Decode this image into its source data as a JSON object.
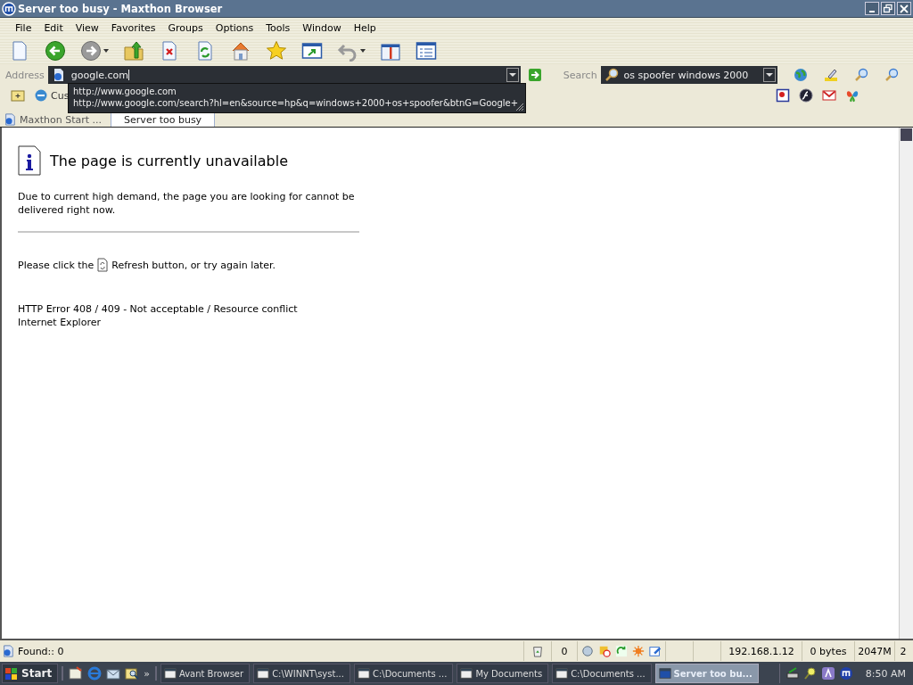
{
  "window": {
    "title": "Server too busy - Maxthon Browser"
  },
  "menu": [
    "File",
    "Edit",
    "View",
    "Favorites",
    "Groups",
    "Options",
    "Tools",
    "Window",
    "Help"
  ],
  "address_bar": {
    "label": "Address",
    "value": "google.com",
    "suggestions": [
      "http://www.google.com",
      "http://www.google.com/search?hl=en&source=hp&q=windows+2000+os+spoofer&btnG=Google+"
    ]
  },
  "search_bar": {
    "label": "Search",
    "value": "os spoofer windows 2000"
  },
  "links_bar": {
    "items": [
      "Cus"
    ]
  },
  "tabs": [
    {
      "label": "Maxthon Start ...",
      "selected": false
    },
    {
      "label": "Server too busy",
      "selected": true
    }
  ],
  "page": {
    "heading": "The page is currently unavailable",
    "message": "Due to current high demand, the page you are looking for cannot be delivered right now.",
    "refresh_before": "Please click the",
    "refresh_after": "Refresh button, or try again later.",
    "error": "HTTP Error 408 / 409 - Not acceptable / Resource conflict",
    "browser": "Internet Explorer"
  },
  "status_bar": {
    "found": "Found:: 0",
    "count": "0",
    "ip": "192.168.1.12",
    "bytes": "0 bytes",
    "memory": "2047M",
    "field_6": "2"
  },
  "taskbar": {
    "start": "Start",
    "more": "»",
    "tasks": [
      {
        "label": "Avant Browser",
        "selected": false
      },
      {
        "label": "C:\\WINNT\\syst...",
        "selected": false
      },
      {
        "label": "C:\\Documents ...",
        "selected": false
      },
      {
        "label": "My Documents",
        "selected": false
      },
      {
        "label": "C:\\Documents ...",
        "selected": false
      },
      {
        "label": "Server too bu...",
        "selected": true
      }
    ],
    "clock": "8:50 AM"
  }
}
